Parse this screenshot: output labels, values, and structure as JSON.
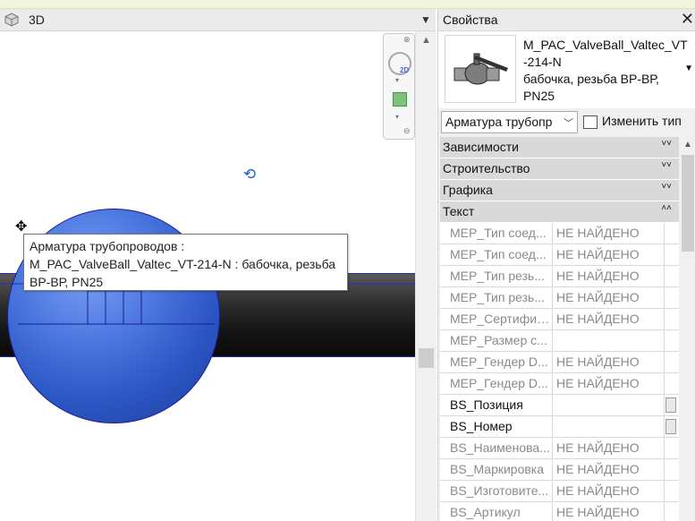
{
  "view": {
    "title": "3D",
    "tooltip_lines": [
      "Арматура трубопроводов :",
      "M_PAC_ValveBall_Valtec_VT-214-N : бабочка, резьба",
      "ВР-ВР, PN25"
    ],
    "nav_2d_label": "2D"
  },
  "properties": {
    "title": "Свойства",
    "type_name_lines": [
      "M_PAC_ValveBall_Valtec_VT",
      "-214-N",
      "бабочка, резьба ВР-ВР,",
      "PN25"
    ],
    "category_select": "Арматура трубопр",
    "edit_type_label": "Изменить тип",
    "groups": [
      {
        "label": "Зависимости",
        "toggle": "˅˅"
      },
      {
        "label": "Строительство",
        "toggle": "˅˅"
      },
      {
        "label": "Графика",
        "toggle": "˅˅"
      },
      {
        "label": "Текст",
        "toggle": "˄˄"
      }
    ],
    "rows": [
      {
        "name": "MEP_Тип соед...",
        "value": "НЕ НАЙДЕНО"
      },
      {
        "name": "MEP_Тип соед...",
        "value": "НЕ НАЙДЕНО"
      },
      {
        "name": "MEP_Тип резь...",
        "value": "НЕ НАЙДЕНО"
      },
      {
        "name": "MEP_Тип резь...",
        "value": "НЕ НАЙДЕНО"
      },
      {
        "name": "MEP_Сертифик...",
        "value": "НЕ НАЙДЕНО"
      },
      {
        "name": "MEP_Размер с...",
        "value": ""
      },
      {
        "name": "MEP_Гендер D...",
        "value": "НЕ НАЙДЕНО"
      },
      {
        "name": "MEP_Гендер D...",
        "value": "НЕ НАЙДЕНО"
      },
      {
        "name": "BS_Позиция",
        "value": ""
      },
      {
        "name": "BS_Номер",
        "value": ""
      },
      {
        "name": "BS_Наименова...",
        "value": "НЕ НАЙДЕНО"
      },
      {
        "name": "BS_Маркировка",
        "value": "НЕ НАЙДЕНО"
      },
      {
        "name": "BS_Изготовите...",
        "value": "НЕ НАЙДЕНО"
      },
      {
        "name": "BS_Артикул",
        "value": "НЕ НАЙДЕНО"
      }
    ]
  }
}
